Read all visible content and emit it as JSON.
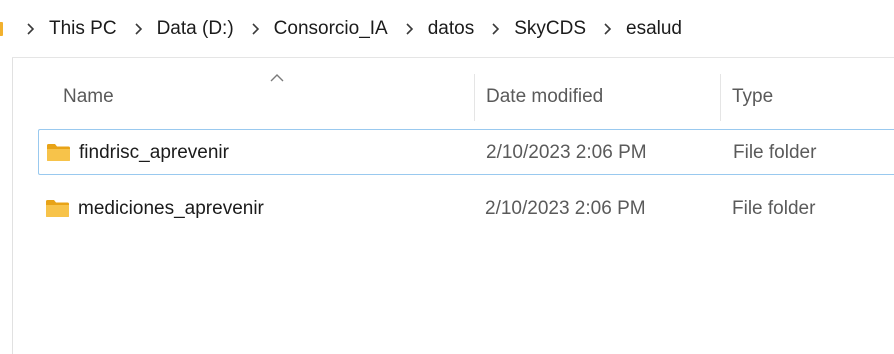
{
  "breadcrumb": {
    "items": [
      "This PC",
      "Data (D:)",
      "Consorcio_IA",
      "datos",
      "SkyCDS",
      "esalud"
    ]
  },
  "columns": {
    "name": "Name",
    "date_modified": "Date modified",
    "type": "Type",
    "sort": "ascending"
  },
  "files": [
    {
      "name": "findrisc_aprevenir",
      "date_modified": "2/10/2023 2:06 PM",
      "type": "File folder",
      "selected": true,
      "icon": "folder-icon"
    },
    {
      "name": "mediciones_aprevenir",
      "date_modified": "2/10/2023 2:06 PM",
      "type": "File folder",
      "selected": false,
      "icon": "folder-icon"
    }
  ],
  "colors": {
    "folder": "#f2b12e",
    "selection_border": "#99c9ef",
    "secondary_text": "#5a5a5a"
  }
}
